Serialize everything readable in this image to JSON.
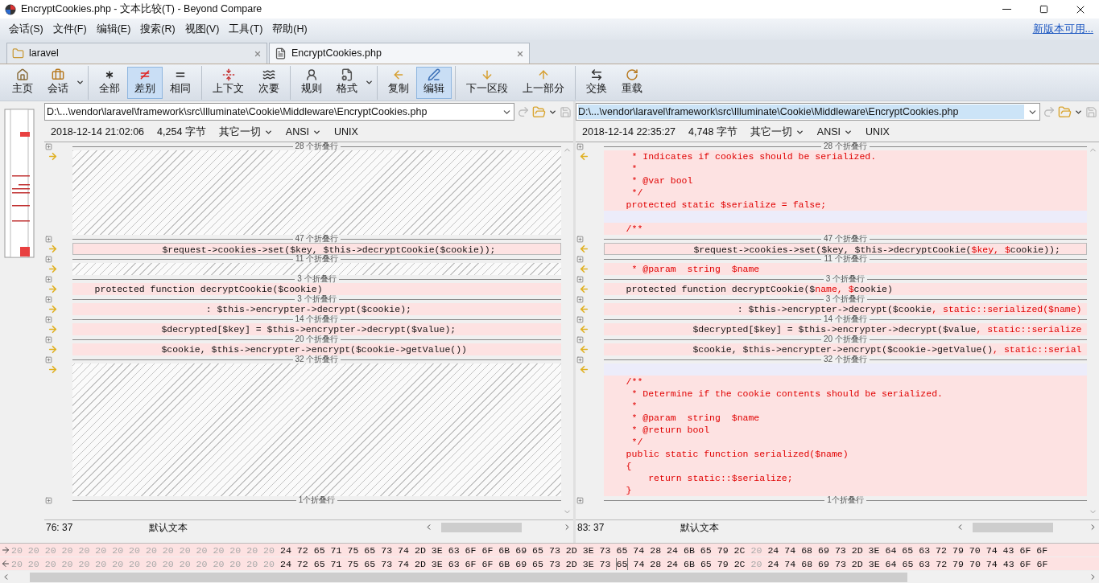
{
  "window": {
    "title": "EncryptCookies.php - 文本比较(T) - Beyond Compare"
  },
  "menu": [
    "会话(S)",
    "文件(F)",
    "编辑(E)",
    "搜索(R)",
    "视图(V)",
    "工具(T)",
    "帮助(H)"
  ],
  "update_link": "新版本可用...",
  "tabs": [
    {
      "label": "laravel",
      "selected": false
    },
    {
      "label": "EncryptCookies.php",
      "selected": true
    }
  ],
  "toolbar": [
    [
      {
        "label": "主页",
        "selected": false,
        "dropdown": false
      },
      {
        "label": "会话",
        "selected": false,
        "dropdown": true
      }
    ],
    [
      {
        "label": "全部",
        "selected": false,
        "dropdown": false
      },
      {
        "label": "差别",
        "selected": true,
        "dropdown": false
      },
      {
        "label": "相同",
        "selected": false,
        "dropdown": false
      }
    ],
    [
      {
        "label": "上下文",
        "selected": false,
        "dropdown": false
      },
      {
        "label": "次要",
        "selected": false,
        "dropdown": false
      }
    ],
    [
      {
        "label": "规则",
        "selected": false,
        "dropdown": false
      },
      {
        "label": "格式",
        "selected": false,
        "dropdown": true
      }
    ],
    [
      {
        "label": "复制",
        "selected": false,
        "dropdown": false
      },
      {
        "label": "编辑",
        "selected": true,
        "dropdown": false
      }
    ],
    [
      {
        "label": "下一区段",
        "selected": false,
        "dropdown": false
      },
      {
        "label": "上一部分",
        "selected": false,
        "dropdown": false
      }
    ],
    [
      {
        "label": "交换",
        "selected": false,
        "dropdown": false
      },
      {
        "label": "重载",
        "selected": false,
        "dropdown": false
      }
    ]
  ],
  "panes": [
    {
      "path": "D:\\...\\vendor\\laravel\\framework\\src\\Illuminate\\Cookie\\Middleware\\EncryptCookies.php",
      "path_selected": false,
      "timestamp": "2018-12-14 21:02:06",
      "size": "4,254 字节",
      "content_type": "其它一切",
      "encoding": "ANSI",
      "line_ending": "UNIX",
      "blocks": [
        {
          "fold": "28 个折叠行",
          "lines": [
            {
              "kind": "hatch"
            },
            {
              "kind": "hatch"
            },
            {
              "kind": "hatch"
            },
            {
              "kind": "hatch"
            },
            {
              "kind": "hatch"
            },
            {
              "kind": "hatch"
            },
            {
              "kind": "hatch"
            }
          ]
        },
        {
          "fold": "47 个折叠行",
          "lines": [
            {
              "kind": "current",
              "segments": [
                {
                  "text": "                $request->cookies->set($key, $this->decryptCookie($cookie));",
                  "changed": false
                }
              ]
            }
          ]
        },
        {
          "fold": "11 个折叠行",
          "lines": [
            {
              "kind": "hatch"
            }
          ]
        },
        {
          "fold": "3 个折叠行",
          "lines": [
            {
              "kind": "changed",
              "segments": [
                {
                  "text": "    protected function decryptCookie($cookie)",
                  "changed": false
                }
              ]
            }
          ]
        },
        {
          "fold": "3 个折叠行",
          "lines": [
            {
              "kind": "changed",
              "segments": [
                {
                  "text": "                        : $this->encrypter->decrypt($cookie);",
                  "changed": false
                }
              ]
            }
          ]
        },
        {
          "fold": "14 个折叠行",
          "lines": [
            {
              "kind": "changed",
              "segments": [
                {
                  "text": "                $decrypted[$key] = $this->encrypter->decrypt($value);",
                  "changed": false
                }
              ]
            }
          ]
        },
        {
          "fold": "20 个折叠行",
          "lines": [
            {
              "kind": "changed",
              "segments": [
                {
                  "text": "                $cookie, $this->encrypter->encrypt($cookie->getValue())",
                  "changed": false
                }
              ]
            }
          ]
        },
        {
          "fold": "32 个折叠行",
          "lines": [
            {
              "kind": "hatch"
            },
            {
              "kind": "hatch"
            },
            {
              "kind": "hatch"
            },
            {
              "kind": "hatch"
            },
            {
              "kind": "hatch"
            },
            {
              "kind": "hatch"
            },
            {
              "kind": "hatch"
            },
            {
              "kind": "hatch"
            },
            {
              "kind": "hatch"
            },
            {
              "kind": "hatch"
            },
            {
              "kind": "hatch"
            }
          ]
        },
        {
          "fold": "1个折叠行"
        }
      ],
      "position": "76: 37",
      "syntax": "默认文本"
    },
    {
      "path": "D:\\...\\vendor\\laravel\\framework\\src\\Illuminate\\Cookie\\Middleware\\EncryptCookies.php",
      "path_selected": true,
      "timestamp": "2018-12-14 22:35:27",
      "size": "4,748 字节",
      "content_type": "其它一切",
      "encoding": "ANSI",
      "line_ending": "UNIX",
      "blocks": [
        {
          "fold": "28 个折叠行",
          "lines": [
            {
              "kind": "changed",
              "segments": [
                {
                  "text": "     * Indicates if cookies should be serialized.",
                  "changed": true
                }
              ]
            },
            {
              "kind": "changed",
              "segments": [
                {
                  "text": "     *",
                  "changed": true
                }
              ]
            },
            {
              "kind": "changed",
              "segments": [
                {
                  "text": "     * @var bool",
                  "changed": true
                }
              ]
            },
            {
              "kind": "changed",
              "segments": [
                {
                  "text": "     */",
                  "changed": true
                }
              ]
            },
            {
              "kind": "changed",
              "segments": [
                {
                  "text": "    protected static $serialize = false;",
                  "changed": true
                }
              ]
            },
            {
              "kind": "blank"
            },
            {
              "kind": "changed",
              "segments": [
                {
                  "text": "    /**",
                  "changed": true
                }
              ]
            }
          ]
        },
        {
          "fold": "47 个折叠行",
          "lines": [
            {
              "kind": "current",
              "segments": [
                {
                  "text": "                $request->cookies->set($key, $this->decryptCookie(",
                  "changed": false
                },
                {
                  "text": "$key, $",
                  "changed": true
                },
                {
                  "text": "cookie));",
                  "changed": false
                }
              ]
            }
          ]
        },
        {
          "fold": "11 个折叠行",
          "lines": [
            {
              "kind": "changed",
              "segments": [
                {
                  "text": "     * @param  string  $name",
                  "changed": true
                }
              ]
            }
          ]
        },
        {
          "fold": "3 个折叠行",
          "lines": [
            {
              "kind": "changed",
              "segments": [
                {
                  "text": "    protected function decryptCookie($",
                  "changed": false
                },
                {
                  "text": "name, $",
                  "changed": true
                },
                {
                  "text": "cookie)",
                  "changed": false
                }
              ]
            }
          ]
        },
        {
          "fold": "3 个折叠行",
          "lines": [
            {
              "kind": "changed",
              "segments": [
                {
                  "text": "                        : $this->encrypter->decrypt($cookie",
                  "changed": false
                },
                {
                  "text": ", static::serialized($name)",
                  "changed": true
                }
              ]
            }
          ]
        },
        {
          "fold": "14 个折叠行",
          "lines": [
            {
              "kind": "changed",
              "segments": [
                {
                  "text": "                $decrypted[$key] = $this->encrypter->decrypt($value",
                  "changed": false
                },
                {
                  "text": ", static::serialize",
                  "changed": true
                }
              ]
            }
          ]
        },
        {
          "fold": "20 个折叠行",
          "lines": [
            {
              "kind": "changed",
              "segments": [
                {
                  "text": "                $cookie, $this->encrypter->encrypt($cookie->getValue()",
                  "changed": false
                },
                {
                  "text": ", static::serial",
                  "changed": true
                }
              ]
            }
          ]
        },
        {
          "fold": "32 个折叠行",
          "lines": [
            {
              "kind": "blank"
            },
            {
              "kind": "changed",
              "segments": [
                {
                  "text": "    /**",
                  "changed": true
                }
              ]
            },
            {
              "kind": "changed",
              "segments": [
                {
                  "text": "     * Determine if the cookie contents should be serialized.",
                  "changed": true
                }
              ]
            },
            {
              "kind": "changed",
              "segments": [
                {
                  "text": "     *",
                  "changed": true
                }
              ]
            },
            {
              "kind": "changed",
              "segments": [
                {
                  "text": "     * @param  string  $name",
                  "changed": true
                }
              ]
            },
            {
              "kind": "changed",
              "segments": [
                {
                  "text": "     * @return bool",
                  "changed": true
                }
              ]
            },
            {
              "kind": "changed",
              "segments": [
                {
                  "text": "     */",
                  "changed": true
                }
              ]
            },
            {
              "kind": "changed",
              "segments": [
                {
                  "text": "    public static function serialized($name)",
                  "changed": true
                }
              ]
            },
            {
              "kind": "changed",
              "segments": [
                {
                  "text": "    {",
                  "changed": true
                }
              ]
            },
            {
              "kind": "changed",
              "segments": [
                {
                  "text": "        return static::$serialize;",
                  "changed": true
                }
              ]
            },
            {
              "kind": "changed",
              "segments": [
                {
                  "text": "    }",
                  "changed": true
                }
              ]
            }
          ]
        },
        {
          "fold": "1个折叠行"
        }
      ],
      "position": "83: 37",
      "syntax": "默认文本"
    }
  ],
  "hex_rows": [
    {
      "segments": [
        {
          "text": "20 20 20 20 20 20 20 20 20 20 20 20 20 20 20 20",
          "dim": true,
          "cursor": false
        },
        {
          "text": "24 72 65 71 75 65 73 74 2D 3E 63 6F 6F 6B 69 65 73 2D 3E 73 65 74 28 24 6B 65 79 2C",
          "dim": false,
          "cursor": false
        },
        {
          "text": "20",
          "dim": true,
          "cursor": false
        },
        {
          "text": "24 74 68 69 73 2D 3E 64 65 63 72 79 70 74 43 6F 6F",
          "dim": false,
          "cursor": false
        }
      ]
    },
    {
      "segments": [
        {
          "text": "20 20 20 20 20 20 20 20 20 20 20 20 20 20 20 20",
          "dim": true,
          "cursor": false
        },
        {
          "text": "24 72 65 71 75 65 73 74 2D 3E 63 6F 6F 6B 69 65 73 2D 3E 73",
          "dim": false,
          "cursor": false
        },
        {
          "text": "65",
          "dim": false,
          "cursor": true
        },
        {
          "text": "74 28 24 6B 65 79 2C",
          "dim": false,
          "cursor": false
        },
        {
          "text": "20",
          "dim": true,
          "cursor": false
        },
        {
          "text": "24 74 68 69 73 2D 3E 64 65 63 72 79 70 74 43 6F 6F",
          "dim": false,
          "cursor": false
        }
      ]
    }
  ]
}
